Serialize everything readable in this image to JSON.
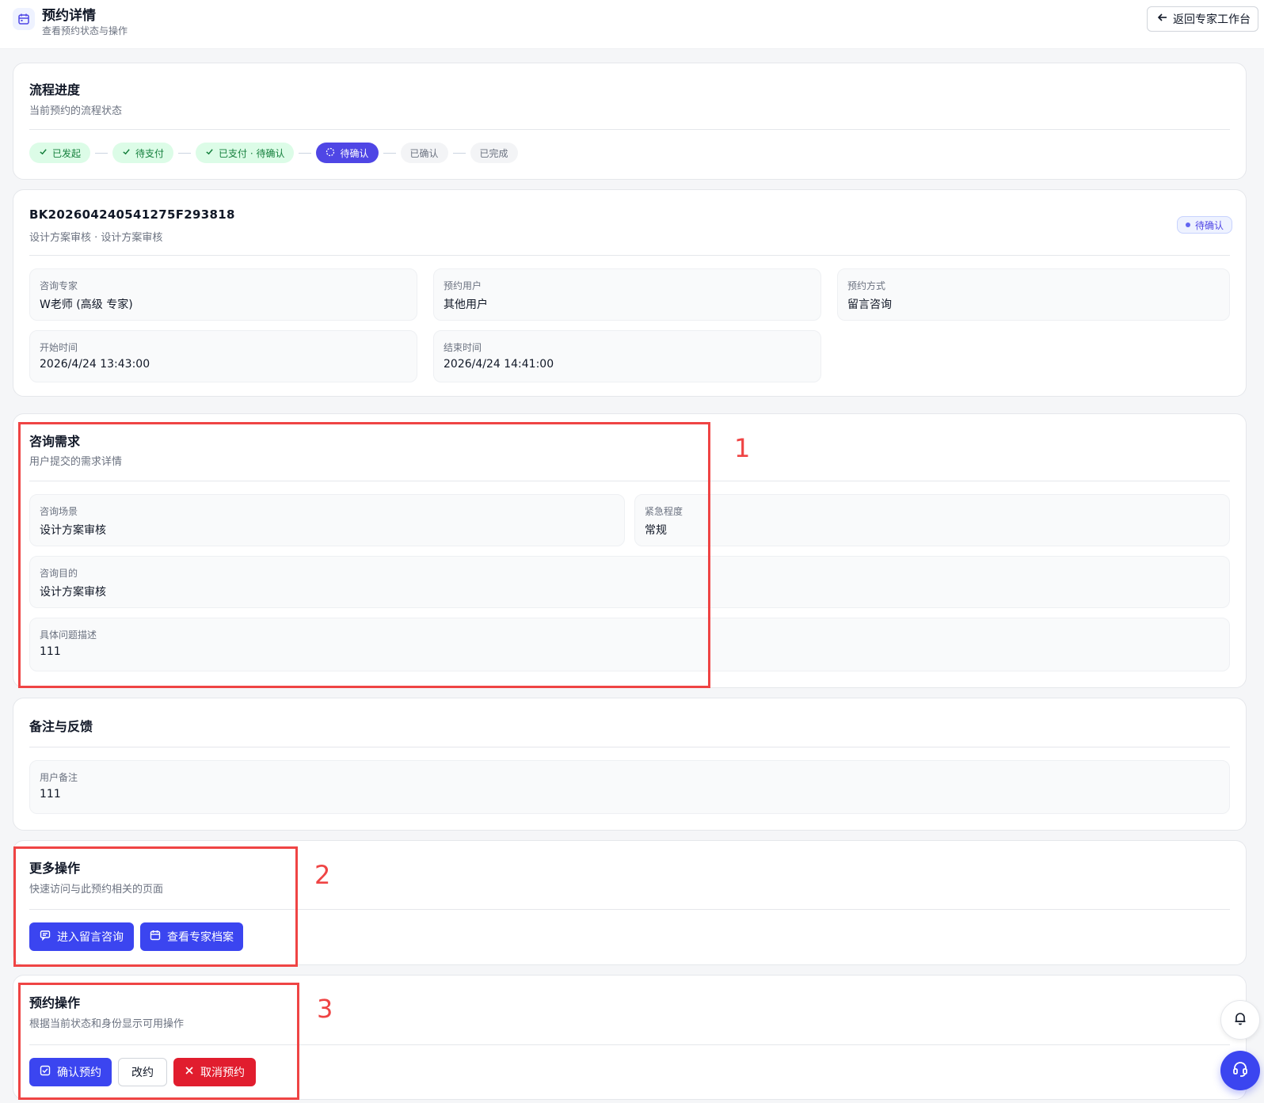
{
  "header": {
    "title": "预约详情",
    "subtitle": "查看预约状态与操作",
    "back_label": "返回专家工作台"
  },
  "progress": {
    "title": "流程进度",
    "subtitle": "当前预约的流程状态",
    "steps": [
      {
        "label": "已发起",
        "state": "done"
      },
      {
        "label": "待支付",
        "state": "done"
      },
      {
        "label": "已支付 · 待确认",
        "state": "done"
      },
      {
        "label": "待确认",
        "state": "active"
      },
      {
        "label": "已确认",
        "state": "pending"
      },
      {
        "label": "已完成",
        "state": "pending"
      }
    ]
  },
  "booking": {
    "id": "BK202604240541275F293818",
    "subtitle": "设计方案审核 · 设计方案审核",
    "status": "待确认",
    "fields": [
      {
        "label": "咨询专家",
        "value": "W老师 (高级 专家)"
      },
      {
        "label": "预约用户",
        "value": "其他用户"
      },
      {
        "label": "预约方式",
        "value": "留言咨询"
      },
      {
        "label": "开始时间",
        "value": "2026/4/24 13:43:00"
      },
      {
        "label": "结束时间",
        "value": "2026/4/24 14:41:00"
      }
    ]
  },
  "requirement": {
    "title": "咨询需求",
    "subtitle": "用户提交的需求详情",
    "fields": [
      {
        "label": "咨询场景",
        "value": "设计方案审核"
      },
      {
        "label": "紧急程度",
        "value": "常规"
      },
      {
        "label": "咨询目的",
        "value": "设计方案审核"
      },
      {
        "label": "具体问题描述",
        "value": "111"
      }
    ]
  },
  "notes": {
    "title": "备注与反馈",
    "fields": [
      {
        "label": "用户备注",
        "value": "111"
      }
    ]
  },
  "more_actions": {
    "title": "更多操作",
    "subtitle": "快速访问与此预约相关的页面",
    "enter_chat_label": "进入留言咨询",
    "view_profile_label": "查看专家档案"
  },
  "booking_actions": {
    "title": "预约操作",
    "subtitle": "根据当前状态和身份显示可用操作",
    "confirm_label": "确认预约",
    "reschedule_label": "改约",
    "cancel_label": "取消预约"
  },
  "annotations": [
    "1",
    "2",
    "3"
  ],
  "colors": {
    "primary": "#3b45f0",
    "danger": "#e11d2e",
    "success_bg": "#dcfce7",
    "success_text": "#15803d",
    "annotation": "#ef4444"
  },
  "icons": [
    "calendar-icon",
    "arrow-left-icon",
    "check-icon",
    "loader-icon",
    "message-icon",
    "calendar-icon",
    "check-square-icon",
    "close-icon",
    "bell-icon",
    "headset-icon"
  ]
}
